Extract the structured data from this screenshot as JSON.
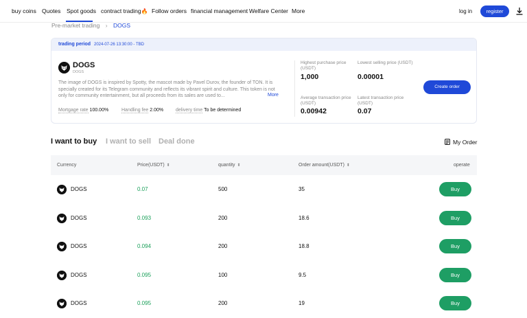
{
  "nav": {
    "items": [
      "buy coins",
      "Quotes",
      "Spot goods",
      "contract trading",
      "Follow orders",
      "financial management",
      "Welfare Center",
      "More"
    ],
    "login": "log in",
    "register": "register"
  },
  "breadcrumb": {
    "parent": "Pre-market trading",
    "current": "DOGS"
  },
  "card": {
    "period_label": "trading period",
    "period_value": "2024-07-26 13:30:00 - TBD",
    "token_name": "DOGS",
    "token_sub": "DOGS",
    "description": "The image of DOGS is inspired by Spotty, the mascot made by Pavel Durov, the founder of TON. It is specially created for its Telegram community and reflects its vibrant spirit and culture. This token is not only for community entertainment, but all proceeds from its sales are used to...",
    "more": "More",
    "mortgage_label": "Mortgage rate",
    "mortgage_value": "100.00%",
    "fee_label": "Handling fee",
    "fee_value": "2.00%",
    "delivery_label": "delivery time",
    "delivery_value": "To be determined",
    "stats": {
      "highest_label": "Highest purchase price (USDT)",
      "highest_value": "1,000",
      "lowest_label": "Lowest selling price (USDT)",
      "lowest_value": "0.00001",
      "avg_label": "Average transaction price (USDT)",
      "avg_value": "0.00942",
      "latest_label": "Latest transaction price (USDT)",
      "latest_value": "0.07"
    },
    "create_order": "Create order"
  },
  "tabs": [
    "I want to buy",
    "I want to sell",
    "Deal done"
  ],
  "my_order": "My Order",
  "table": {
    "headers": {
      "currency": "Currency",
      "price": "Price(USDT)",
      "quantity": "quantity",
      "amount": "Order amount(USDT)",
      "operate": "operate"
    },
    "rows": [
      {
        "coin": "DOGS",
        "price": "0.07",
        "quantity": "500",
        "amount": "35",
        "action": "Buy"
      },
      {
        "coin": "DOGS",
        "price": "0.093",
        "quantity": "200",
        "amount": "18.6",
        "action": "Buy"
      },
      {
        "coin": "DOGS",
        "price": "0.094",
        "quantity": "200",
        "amount": "18.8",
        "action": "Buy"
      },
      {
        "coin": "DOGS",
        "price": "0.095",
        "quantity": "100",
        "amount": "9.5",
        "action": "Buy"
      },
      {
        "coin": "DOGS",
        "price": "0.095",
        "quantity": "200",
        "amount": "19",
        "action": "Buy"
      }
    ]
  },
  "colors": {
    "accent": "#1f49d8",
    "buy_button": "#1e9e64",
    "price_green": "#1ba05a"
  }
}
